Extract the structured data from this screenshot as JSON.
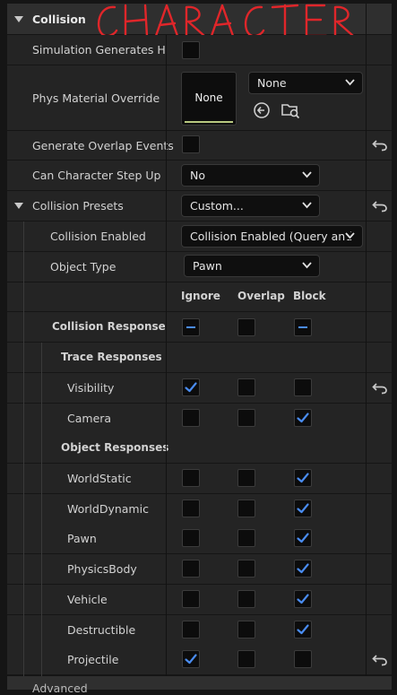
{
  "section": {
    "title": "Collision",
    "overlay": "CHARACTER",
    "overlay_color": "#e0262a"
  },
  "props": {
    "sim_hits": "Simulation Generates Hi...",
    "phys_material": "Phys Material Override",
    "phys_preview_label": "None",
    "phys_dropdown_value": "None",
    "overlap_events": "Generate Overlap Events",
    "step_up": "Can Character Step Up On",
    "step_up_value": "No",
    "presets": "Collision Presets",
    "presets_value": "Custom...",
    "enabled": "Collision Enabled",
    "enabled_value": "Collision Enabled (Query and",
    "object_type": "Object Type",
    "object_type_value": "Pawn"
  },
  "columns": {
    "ignore": "Ignore",
    "overlap": "Overlap",
    "block": "Block"
  },
  "responses": {
    "title": "Collision Responses",
    "trace_title": "Trace Responses",
    "object_title": "Object Responses",
    "trace": [
      {
        "name": "Visibility",
        "ignore": true,
        "overlap": false,
        "block": false,
        "reset": true
      },
      {
        "name": "Camera",
        "ignore": false,
        "overlap": false,
        "block": true,
        "reset": false
      }
    ],
    "object": [
      {
        "name": "WorldStatic",
        "ignore": false,
        "overlap": false,
        "block": true,
        "reset": false
      },
      {
        "name": "WorldDynamic",
        "ignore": false,
        "overlap": false,
        "block": true,
        "reset": false
      },
      {
        "name": "Pawn",
        "ignore": false,
        "overlap": false,
        "block": true,
        "reset": false
      },
      {
        "name": "PhysicsBody",
        "ignore": false,
        "overlap": false,
        "block": true,
        "reset": false
      },
      {
        "name": "Vehicle",
        "ignore": false,
        "overlap": false,
        "block": true,
        "reset": false
      },
      {
        "name": "Destructible",
        "ignore": false,
        "overlap": false,
        "block": true,
        "reset": false
      },
      {
        "name": "Projectile",
        "ignore": true,
        "overlap": false,
        "block": false,
        "reset": true
      }
    ]
  },
  "next_section": "Advanced",
  "colors": {
    "check": "#4a8cf0",
    "reset": "#c8c8c8",
    "bg": "#151515"
  }
}
